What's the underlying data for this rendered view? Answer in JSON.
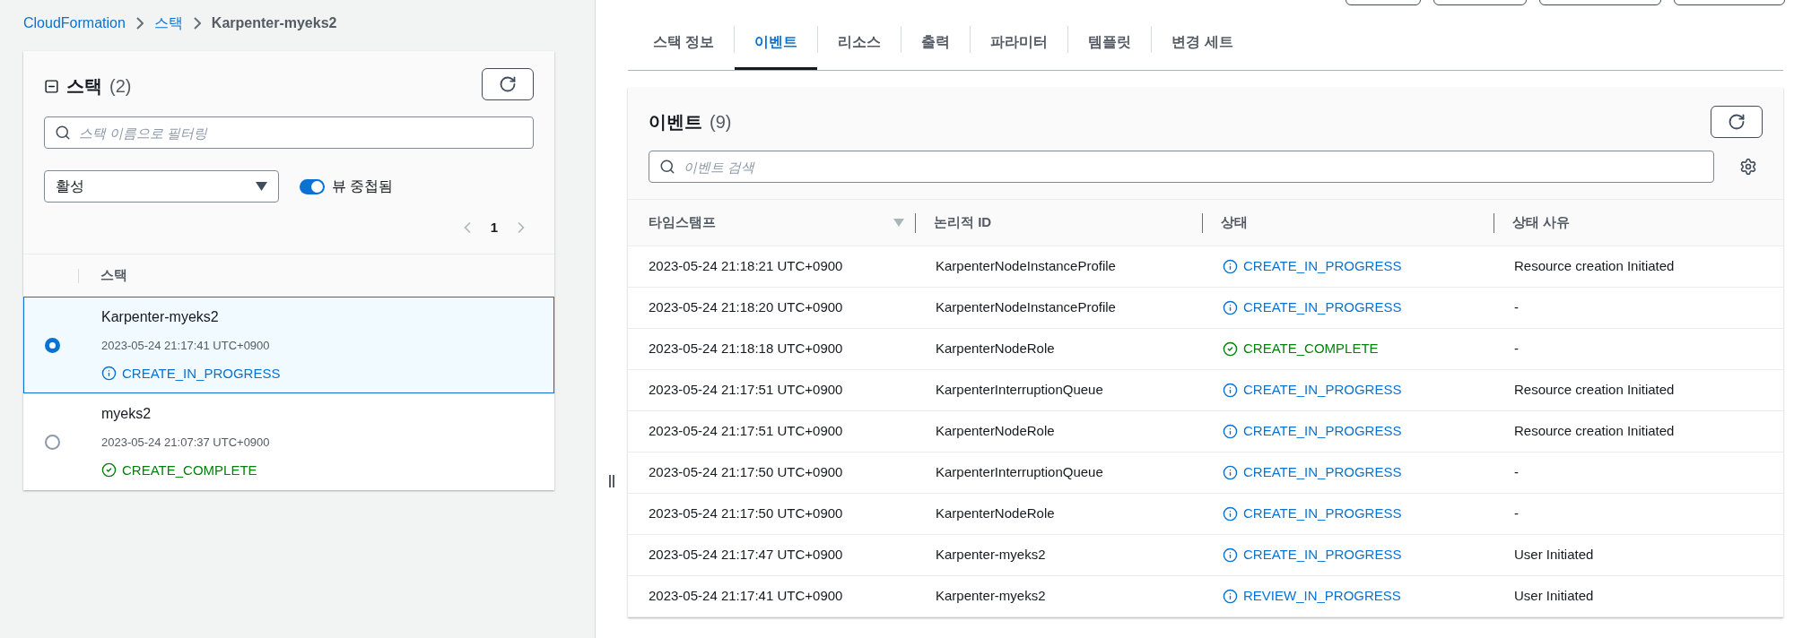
{
  "breadcrumb": [
    {
      "label": "CloudFormation",
      "link": true
    },
    {
      "label": "스택",
      "link": true
    },
    {
      "label": "Karpenter-myeks2",
      "link": false
    }
  ],
  "stacks_panel": {
    "title": "스택",
    "count": "(2)",
    "expanded": true,
    "search": {
      "placeholder": "스택 이름으로 필터링"
    },
    "filter": {
      "value": "활성"
    },
    "nested_toggle": {
      "label": "뷰 중첩됨",
      "on": true
    },
    "pagination": {
      "page": "1"
    },
    "column": "스택",
    "stacks": [
      {
        "name": "Karpenter-myeks2",
        "time": "2023-05-24 21:17:41 UTC+0900",
        "status": "CREATE_IN_PROGRESS",
        "kind": "in_progress",
        "selected": true
      },
      {
        "name": "myeks2",
        "time": "2023-05-24 21:07:37 UTC+0900",
        "status": "CREATE_COMPLETE",
        "kind": "complete",
        "selected": false
      }
    ]
  },
  "tabs": [
    {
      "label": "스택 정보",
      "selected": false
    },
    {
      "label": "이벤트",
      "selected": true
    },
    {
      "label": "리소스",
      "selected": false
    },
    {
      "label": "출력",
      "selected": false
    },
    {
      "label": "파라미터",
      "selected": false
    },
    {
      "label": "템플릿",
      "selected": false
    },
    {
      "label": "변경 세트",
      "selected": false
    }
  ],
  "events": {
    "title": "이벤트",
    "count": "(9)",
    "search": {
      "placeholder": "이벤트 검색"
    },
    "columns": [
      "타임스탬프",
      "논리적 ID",
      "상태",
      "상태 사유"
    ],
    "rows": [
      {
        "time": "2023-05-24 21:18:21 UTC+0900",
        "id": "KarpenterNodeInstanceProfile",
        "status": "CREATE_IN_PROGRESS",
        "kind": "in_progress",
        "reason": "Resource creation Initiated"
      },
      {
        "time": "2023-05-24 21:18:20 UTC+0900",
        "id": "KarpenterNodeInstanceProfile",
        "status": "CREATE_IN_PROGRESS",
        "kind": "in_progress",
        "reason": "-"
      },
      {
        "time": "2023-05-24 21:18:18 UTC+0900",
        "id": "KarpenterNodeRole",
        "status": "CREATE_COMPLETE",
        "kind": "complete",
        "reason": "-"
      },
      {
        "time": "2023-05-24 21:17:51 UTC+0900",
        "id": "KarpenterInterruptionQueue",
        "status": "CREATE_IN_PROGRESS",
        "kind": "in_progress",
        "reason": "Resource creation Initiated"
      },
      {
        "time": "2023-05-24 21:17:51 UTC+0900",
        "id": "KarpenterNodeRole",
        "status": "CREATE_IN_PROGRESS",
        "kind": "in_progress",
        "reason": "Resource creation Initiated"
      },
      {
        "time": "2023-05-24 21:17:50 UTC+0900",
        "id": "KarpenterInterruptionQueue",
        "status": "CREATE_IN_PROGRESS",
        "kind": "in_progress",
        "reason": "-"
      },
      {
        "time": "2023-05-24 21:17:50 UTC+0900",
        "id": "KarpenterNodeRole",
        "status": "CREATE_IN_PROGRESS",
        "kind": "in_progress",
        "reason": "-"
      },
      {
        "time": "2023-05-24 21:17:47 UTC+0900",
        "id": "Karpenter-myeks2",
        "status": "CREATE_IN_PROGRESS",
        "kind": "in_progress",
        "reason": "User Initiated"
      },
      {
        "time": "2023-05-24 21:17:41 UTC+0900",
        "id": "Karpenter-myeks2",
        "status": "REVIEW_IN_PROGRESS",
        "kind": "in_progress",
        "reason": "User Initiated"
      }
    ]
  }
}
